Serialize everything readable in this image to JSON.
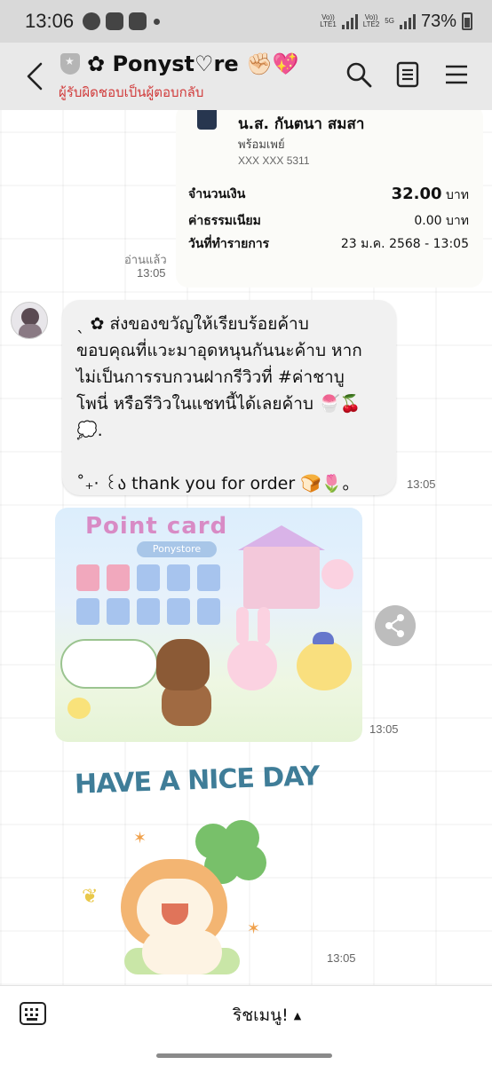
{
  "status_bar": {
    "time": "13:06",
    "sim1_label": "Vo))\nLTE1",
    "sim2_label": "Vo))\nLTE2",
    "network": "5G",
    "battery": "73%"
  },
  "header": {
    "title": "✿ Ponyst♡re ✊🏻💖",
    "subtitle": "ผู้รับผิดชอบเป็นผู้ตอบกลับ"
  },
  "payment_card": {
    "recipient_name": "น.ส. กันตนา สมสา",
    "method": "พร้อมเพย์",
    "account": "XXX XXX 5311",
    "rows": [
      {
        "label": "จำนวนเงิน",
        "value": "32.00",
        "unit": "บาท"
      },
      {
        "label": "ค่าธรรมเนียม",
        "value": "0.00",
        "unit": "บาท"
      },
      {
        "label": "วันที่ทำรายการ",
        "value": "23 ม.ค. 2568 - 13:05",
        "unit": ""
      }
    ],
    "read_label": "อ่านแล้ว",
    "time": "13:05"
  },
  "message": {
    "text": "ˎ ✿ ส่งของขวัญให้เรียบร้อยค้าบ\nขอบคุณที่แวะมาอุดหนุนกันนะค้าบ หาก\nไม่เป็นการรบกวนฝากรีวิวที่ #ค่าชาบู\nโพนี่ หรือรีวิวในแชทนี้ได้เลยค้าบ 🍧🍒\n💭.\n\n  ˚₊‧ ꒰ა thank you for order 🍞🌷。",
    "time": "13:05"
  },
  "point_card": {
    "title": "Point card",
    "subtitle": "Ponystore",
    "time": "13:05"
  },
  "sticker": {
    "text": "HAVE A NICE DAY",
    "time": "13:05"
  },
  "bottom_bar": {
    "rich_menu_label": "ริชเมนู!",
    "rich_menu_arrow": "▲"
  }
}
